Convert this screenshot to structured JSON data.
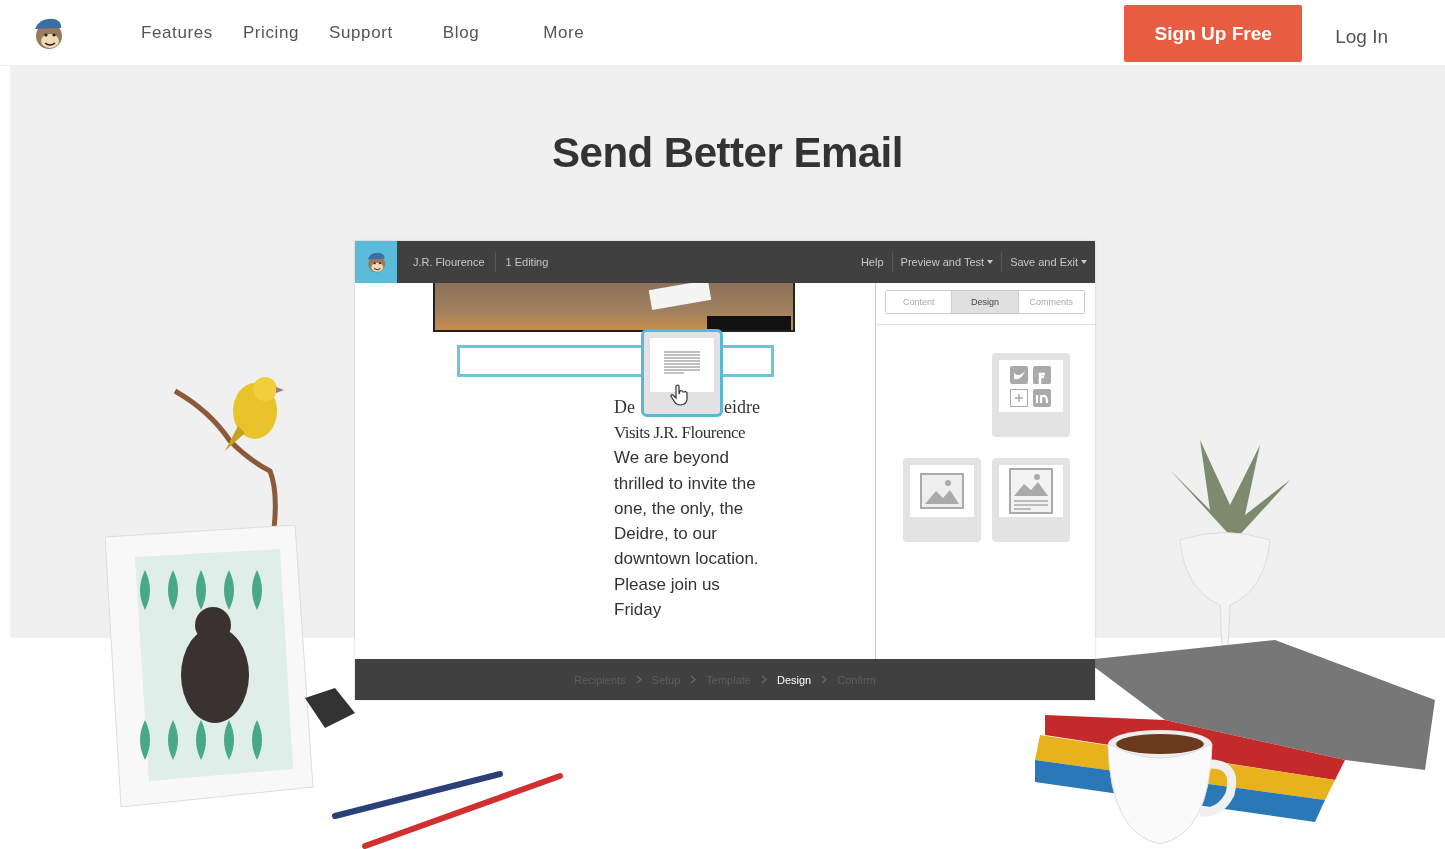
{
  "nav": {
    "links": [
      "Features",
      "Pricing",
      "Support",
      "Blog",
      "More"
    ],
    "signup": "Sign Up Free",
    "login": "Log In"
  },
  "hero": {
    "title": "Send Better Email"
  },
  "editor": {
    "campaign": "J.R. Flourence",
    "editing": "1 Editing",
    "menu": [
      {
        "label": "Help",
        "dropdown": false
      },
      {
        "label": "Preview and Test",
        "dropdown": true
      },
      {
        "label": "Save and Exit",
        "dropdown": true
      }
    ],
    "email": {
      "heading_start": "De",
      "heading_end": "eidre",
      "heading_rest": "Visits J.R. Flourence",
      "body": "We are beyond thrilled to invite the one, the only, the Deidre, to our downtown location. Please join us Friday"
    },
    "panel_tabs": [
      {
        "label": "Content",
        "selected": false
      },
      {
        "label": "Design",
        "selected": true
      },
      {
        "label": "Comments",
        "selected": false
      }
    ],
    "content_blocks": [
      {
        "kind": "social"
      },
      {
        "kind": "image"
      },
      {
        "kind": "image-text"
      }
    ],
    "steps": [
      {
        "label": "Recipients",
        "selected": false
      },
      {
        "label": "Setup",
        "selected": false
      },
      {
        "label": "Template",
        "selected": false
      },
      {
        "label": "Design",
        "selected": true
      },
      {
        "label": "Confirm",
        "selected": false
      }
    ]
  }
}
